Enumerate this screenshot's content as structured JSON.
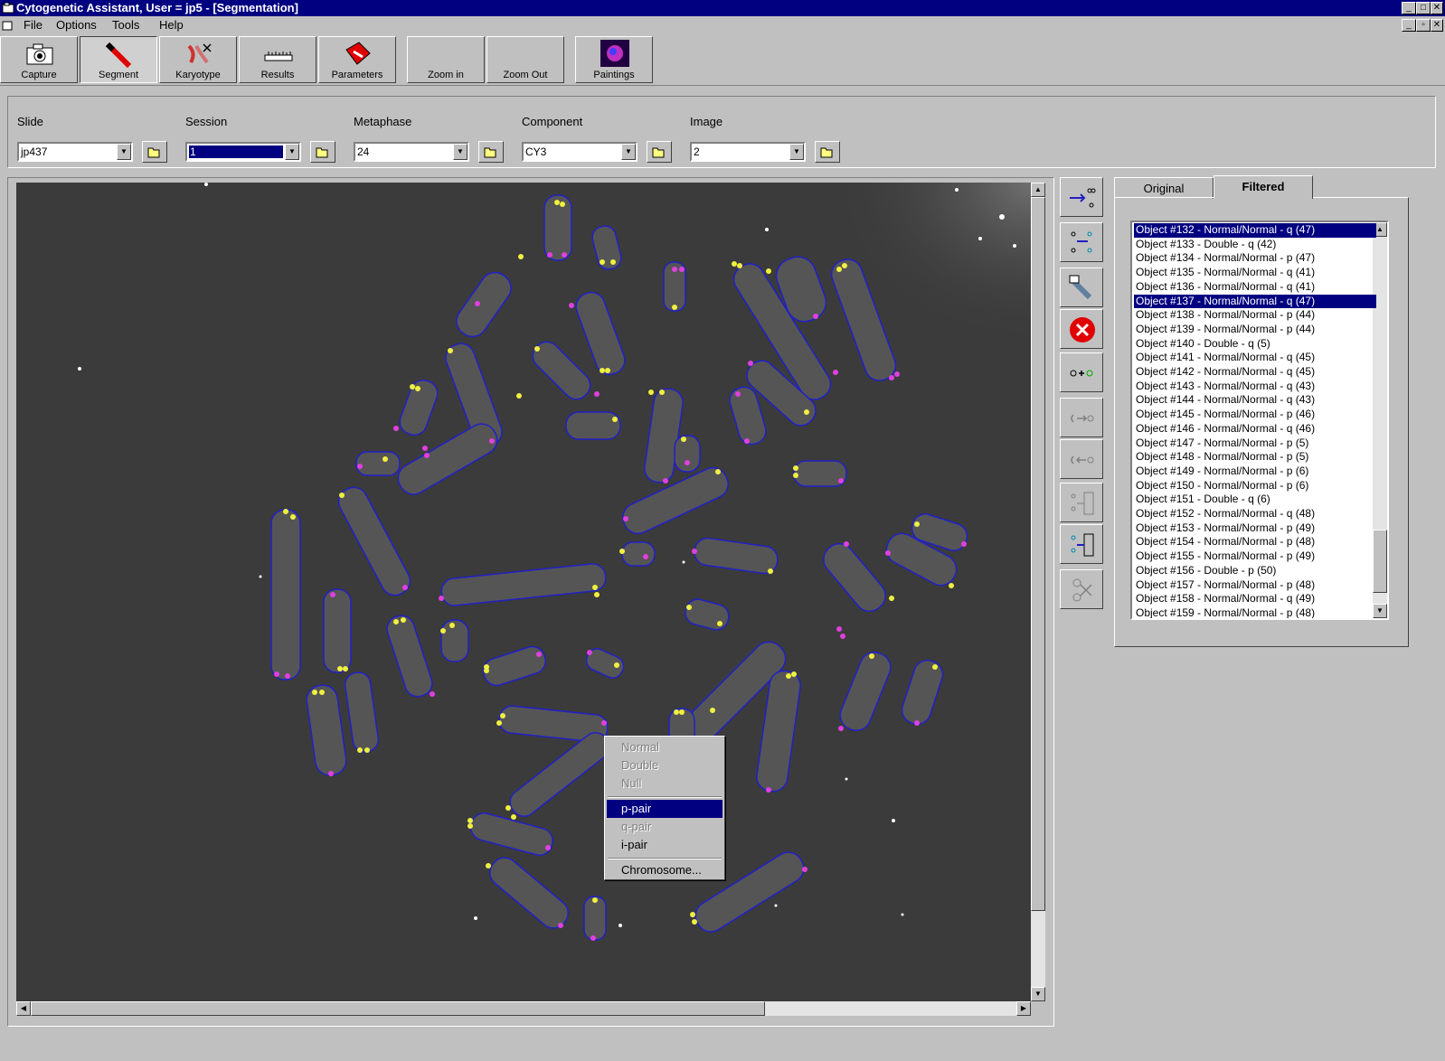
{
  "window": {
    "title": "Cytogenetic Assistant,  User = jp5 - [Segmentation]"
  },
  "menu": {
    "items": [
      "File",
      "Options",
      "Tools",
      "Help"
    ]
  },
  "toolbar": {
    "capture": "Capture",
    "segment": "Segment",
    "karyotype": "Karyotype",
    "results": "Results",
    "parameters": "Parameters",
    "zoom_in": "Zoom in",
    "zoom_out": "Zoom Out",
    "paintings": "Paintings"
  },
  "selectors": {
    "slide": {
      "label": "Slide",
      "value": "jp437"
    },
    "session": {
      "label": "Session",
      "value": "1"
    },
    "metaphase": {
      "label": "Metaphase",
      "value": "24"
    },
    "component": {
      "label": "Component",
      "value": "CY3"
    },
    "image": {
      "label": "Image",
      "value": "2"
    }
  },
  "context_menu": {
    "normal": "Normal",
    "double": "Double",
    "null": "Null",
    "p_pair": "p-pair",
    "q_pair": "q-pair",
    "i_pair": "i-pair",
    "chromosome": "Chromosome..."
  },
  "tabs": {
    "original": "Original",
    "filtered": "Filtered",
    "active": "Filtered"
  },
  "objects": [
    {
      "label": "Object #132 - Normal/Normal - q (47)",
      "selected": true
    },
    {
      "label": "Object #133 - Double - q (42)",
      "selected": false
    },
    {
      "label": "Object #134 - Normal/Normal - p (47)",
      "selected": false
    },
    {
      "label": "Object #135 - Normal/Normal - q (41)",
      "selected": false
    },
    {
      "label": "Object #136 - Normal/Normal - q (41)",
      "selected": false
    },
    {
      "label": "Object #137 - Normal/Normal - q (47)",
      "selected": true
    },
    {
      "label": "Object #138 - Normal/Normal - p (44)",
      "selected": false
    },
    {
      "label": "Object #139 - Normal/Normal - p (44)",
      "selected": false
    },
    {
      "label": "Object #140 - Double - q (5)",
      "selected": false
    },
    {
      "label": "Object #141 - Normal/Normal - q (45)",
      "selected": false
    },
    {
      "label": "Object #142 - Normal/Normal - q (45)",
      "selected": false
    },
    {
      "label": "Object #143 - Normal/Normal - q (43)",
      "selected": false
    },
    {
      "label": "Object #144 - Normal/Normal - q (43)",
      "selected": false
    },
    {
      "label": "Object #145 - Normal/Normal - p (46)",
      "selected": false
    },
    {
      "label": "Object #146 - Normal/Normal - q (46)",
      "selected": false
    },
    {
      "label": "Object #147 - Normal/Normal - p (5)",
      "selected": false
    },
    {
      "label": "Object #148 - Normal/Normal - p (5)",
      "selected": false
    },
    {
      "label": "Object #149 - Normal/Normal - p (6)",
      "selected": false
    },
    {
      "label": "Object #150 - Normal/Normal - p (6)",
      "selected": false
    },
    {
      "label": "Object #151 - Double - q (6)",
      "selected": false
    },
    {
      "label": "Object #152 - Normal/Normal - q (48)",
      "selected": false
    },
    {
      "label": "Object #153 - Normal/Normal - p (49)",
      "selected": false
    },
    {
      "label": "Object #154 - Normal/Normal - p (48)",
      "selected": false
    },
    {
      "label": "Object #155 - Normal/Normal - p (49)",
      "selected": false
    },
    {
      "label": "Object #156 - Double - p (50)",
      "selected": false
    },
    {
      "label": "Object #157 - Normal/Normal - p (48)",
      "selected": false
    },
    {
      "label": "Object #158 - Normal/Normal - q (49)",
      "selected": false
    },
    {
      "label": "Object #159 - Normal/Normal - p (48)",
      "selected": false
    }
  ],
  "colors": {
    "titlebar": "#000080",
    "selection": "#000080",
    "image_bg": "#3b3b3b",
    "outline": "#2020c8",
    "telomere_yellow": "#f0f040",
    "telomere_magenta": "#e040e0"
  }
}
